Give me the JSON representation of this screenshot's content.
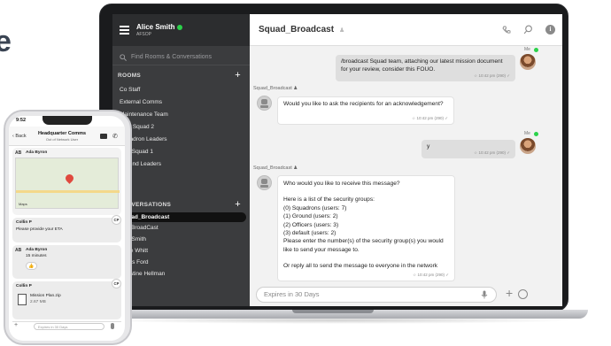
{
  "title_fragment": "e",
  "app": {
    "user": {
      "name": "Alice Smith",
      "org": "AFSOP"
    },
    "search_placeholder": "Find Rooms & Conversations",
    "rooms_header": "ROOMS",
    "rooms": [
      "Co Staff",
      "External Comms",
      "Maintenance Team",
      "Blue Squad 2",
      "Squadron Leaders",
      "Red Squad 1",
      "Ground Leaders"
    ],
    "conversations_header": "CONVERSATIONS",
    "conversations": [
      "Squad_Broadcast",
      "SQ_BroadCast",
      "Bob Smith",
      "Jeffie Whitt",
      "Harris Ford",
      "Christine Hellman"
    ],
    "chat_title": "Squad_Broadcast",
    "composer_placeholder": "Expires in 30 Days",
    "messages": [
      {
        "sender": "Me",
        "text": "/broadcast Squad team, attaching our latest mission document for your review, consider this FOUO.",
        "meta": "10:42 pm (290)"
      },
      {
        "sender": "Squad_Broadcast",
        "text": "Would you like to ask the recipients for an acknowledgement?",
        "meta": "10:42 pm (290)"
      },
      {
        "sender": "Me",
        "text": "y",
        "meta": "10:42 pm (290)"
      },
      {
        "sender": "Squad_Broadcast",
        "meta": "10:42 pm (290)",
        "lines": [
          "Who would you like to receive this message?",
          "",
          "Here is a list of the security groups:",
          "(0) Squadrons (users: 7)",
          "(1) Ground (users: 2)",
          "(2) Officers (users: 3)",
          "(3) default (users: 2)",
          "Please enter the number(s) of the security group(s) you would like to send your message to.",
          "",
          "Or reply all to send the message to everyone in the network"
        ]
      }
    ]
  },
  "phone": {
    "time": "9:52",
    "back": "Back",
    "title": "Headquarter Comms",
    "subtitle": "Out of Network User",
    "card1_sender": "Ada Byron",
    "card1_initials": "AB",
    "map_label": "Maps",
    "card2_sender": "Collin P",
    "card2_text": "Please provide your ETA",
    "card3_sender": "Ada Byron",
    "card3_text": "15 minutes",
    "card4_sender": "Collin P",
    "file_name": "Mission Plan.zip",
    "file_size": "2.67 MB",
    "cp_initials": "CP",
    "input_placeholder": "Expires in 30 Days"
  }
}
